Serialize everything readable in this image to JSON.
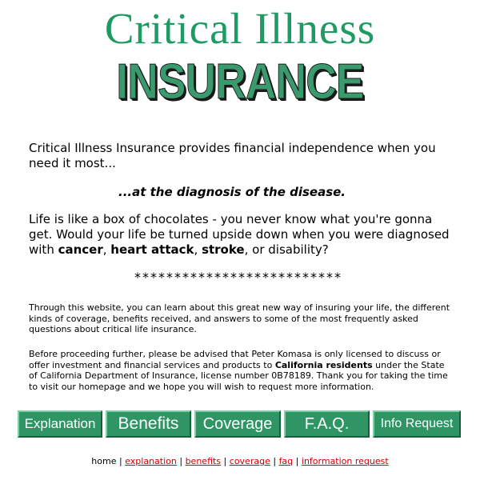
{
  "header": {
    "title_line1": "Critical Illness",
    "title_line2": "INSURANCE"
  },
  "intro": {
    "text": "Critical Illness Insurance provides financial independence when you need it most..."
  },
  "tagline": "...at the diagnosis of the disease.",
  "para2": {
    "part1": "Life is like a box of chocolates - you never know what you're gonna get. Would your life be turned upside down when you were diagnosed with ",
    "cancer": "cancer",
    "sep1": ", ",
    "heart_attack": "heart attack",
    "sep2": ", ",
    "stroke": "stroke",
    "part2": ", or disability?"
  },
  "stars": "**************************",
  "para3": "Through this website, you can learn about this great new way of insuring your life, the different kinds of coverage, benefits received, and answers to some of the most frequently asked questions about critical life insurance.",
  "para4": {
    "part1": "Before proceeding further, please be advised that Peter Komasa is only licensed to discuss or offer investment and financial services and products to ",
    "bold": "California residents",
    "part2": " under the State of California Department of Insurance, license number 0B78189. Thank you for taking the time to visit our homepage and we hope you will wish to request more information."
  },
  "nav_buttons": {
    "explanation": "Explanation",
    "benefits": "Benefits",
    "coverage": "Coverage",
    "faq": "F.A.Q.",
    "info_request": "Info Request"
  },
  "footer_links": {
    "home": "home",
    "explanation": "explanation",
    "benefits": "benefits",
    "coverage": "coverage",
    "faq": "faq",
    "information_request": "information request",
    "separator": "|"
  },
  "colors": {
    "brand_green": "#1e9a63",
    "button_green": "#2f9564",
    "link_red": "#cc0000"
  }
}
